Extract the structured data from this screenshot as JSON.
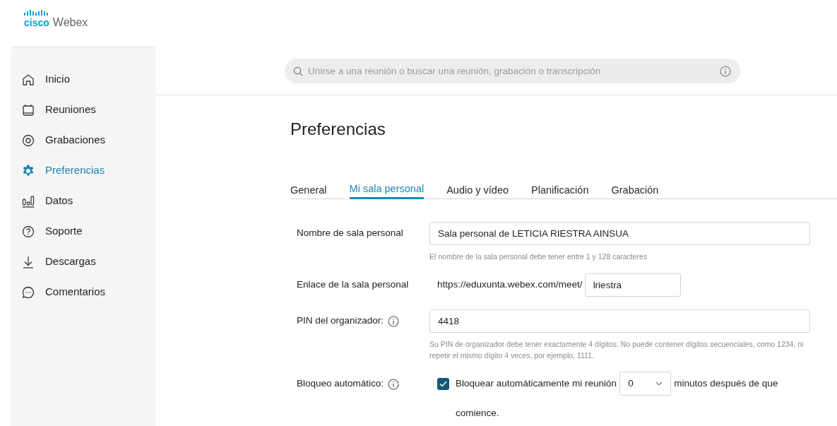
{
  "logo": {
    "brand": "cisco",
    "product": "Webex"
  },
  "sidebar": {
    "items": [
      {
        "label": "Inicio",
        "kind": "home",
        "selected": false
      },
      {
        "label": "Reuniones",
        "kind": "calendar",
        "selected": false
      },
      {
        "label": "Grabaciones",
        "kind": "record",
        "selected": false
      },
      {
        "label": "Preferencias",
        "kind": "gear",
        "selected": true
      },
      {
        "label": "Datos",
        "kind": "chart",
        "selected": false
      },
      {
        "label": "Soporte",
        "kind": "help",
        "selected": false
      },
      {
        "label": "Descargas",
        "kind": "download",
        "selected": false
      },
      {
        "label": "Comentarios",
        "kind": "chat",
        "selected": false
      }
    ]
  },
  "search": {
    "placeholder": "Unirse a una reunión o buscar una reunión, grabación o transcripción"
  },
  "page_title": "Preferencias",
  "tabs": [
    {
      "label": "General",
      "selected": false
    },
    {
      "label": "Mi sala personal",
      "selected": true
    },
    {
      "label": "Audio y vídeo",
      "selected": false
    },
    {
      "label": "Planificación",
      "selected": false
    },
    {
      "label": "Grabación",
      "selected": false
    }
  ],
  "form": [
    {
      "kind": "text",
      "label": "Nombre de sala personal",
      "info": false,
      "value": "Sala personal de LETICIA RIESTRA AINSUA",
      "hint": "El nombre de la sala personal debe tener entre 1 y 128 caracteres"
    },
    {
      "kind": "link",
      "label": "Enlace de la sala personal",
      "info": false,
      "prefix": "https://eduxunta.webex.com/meet/",
      "value": "lriestra"
    },
    {
      "kind": "text",
      "label": "PIN del organizador:",
      "info": true,
      "value": "4418",
      "hint": "Su PIN de organizador debe tener exactamente 4 dígitos. No puede contener dígitos secuenciales, como 1234, ni repetir el mismo dígito 4 veces, por ejemplo, 1111."
    },
    {
      "kind": "lock",
      "label": "Bloqueo automático:",
      "info": true,
      "checked": true,
      "text_before": "Bloquear automáticamente mi reunión",
      "value": "0",
      "text_after": "minutos después de que",
      "text_continued": "comience."
    }
  ]
}
